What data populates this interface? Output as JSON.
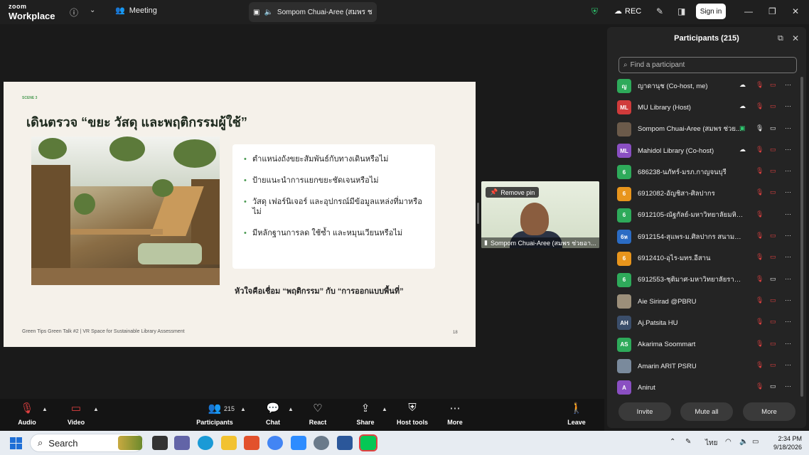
{
  "titlebar": {
    "brand_top": "zoom",
    "brand_bottom": "Workplace",
    "meeting_label": "Meeting",
    "share_tab_label": "Sompom Chuai-Aree (สมพร ช",
    "rec_label": "REC",
    "signin_label": "Sign in"
  },
  "slide": {
    "scene": "SCENE 3",
    "title": "เดินตรวจ “ขยะ วัสดุ และพฤติกรรมผู้ใช้”",
    "bullets": [
      "ตำแหน่งถังขยะสัมพันธ์กับทางเดินหรือไม่",
      "ป้ายแนะนำการแยกขยะชัดเจนหรือไม่",
      "วัสดุ เฟอร์นิเจอร์ และอุปกรณ์มีข้อมูลแหล่งที่มาหรือไม่",
      "มีหลักฐานการลด ใช้ซ้ำ และหมุนเวียนหรือไม่"
    ],
    "summary": "หัวใจคือเชื่อม “พฤติกรรม” กับ “การออกแบบพื้นที่”",
    "footer": "Green Tips Green Talk #2  |  VR Space for Sustainable Library Assessment",
    "page_number": "18"
  },
  "thumbnail": {
    "remove_pin_label": "Remove pin",
    "name": "Sompom Chuai-Aree (สมพร ช่วยอา..."
  },
  "participants": {
    "title": "Participants (215)",
    "search_placeholder": "Find a participant",
    "list": [
      {
        "initials": "ญ",
        "name": "ญาดานุช (Co-host, me)",
        "color": "#2eaa5a"
      },
      {
        "initials": "ML",
        "name": "MU Library (Host)",
        "color": "#d03b3b"
      },
      {
        "initials": "",
        "name": "Sompom Chuai-Aree (สมพร ช่วย...",
        "color": "#6b5a4a"
      },
      {
        "initials": "ML",
        "name": "Mahidol Library (Co-host)",
        "color": "#8a4fc2"
      },
      {
        "initials": "6",
        "name": "686238-นภัทร์-มรภ.กาญจนบุรี",
        "color": "#2eaa5a"
      },
      {
        "initials": "6",
        "name": "6912082-อัญชิสา-ศิลปากร",
        "color": "#e8951c"
      },
      {
        "initials": "6",
        "name": "6912105-ณัฐกัลย์-มหาวิทยาลัยมหิดล",
        "color": "#2eaa5a"
      },
      {
        "initials": "6ห",
        "name": "6912154-สุแพร-ม.ศิลปากร สนามจันทร์",
        "color": "#2b6cc4"
      },
      {
        "initials": "6",
        "name": "6912410-อุไร-มทร.อีสาน",
        "color": "#e8951c"
      },
      {
        "initials": "6",
        "name": "6912553-ชุติมาศ-มหาวิทยาลัยราชภัฏย...",
        "color": "#2eaa5a"
      },
      {
        "initials": "",
        "name": "Aie Sirirad @PBRU",
        "color": "#9c8f7a"
      },
      {
        "initials": "AH",
        "name": "Aj.Patsita HU",
        "color": "#3b4e6b"
      },
      {
        "initials": "AS",
        "name": "Akarima Soommart",
        "color": "#2eaa5a"
      },
      {
        "initials": "",
        "name": "Amarin ARIT PSRU",
        "color": "#7a8a9c"
      },
      {
        "initials": "A",
        "name": "Anirut",
        "color": "#8a4fc2"
      }
    ],
    "invite_label": "Invite",
    "mute_all_label": "Mute all",
    "more_label": "More"
  },
  "toolbar": {
    "audio": "Audio",
    "video": "Video",
    "participants": "Participants",
    "participants_count": "215",
    "chat": "Chat",
    "react": "React",
    "share": "Share",
    "host_tools": "Host tools",
    "more": "More",
    "leave": "Leave"
  },
  "taskbar": {
    "search_label": "Search",
    "language": "ไทย",
    "time": "2:34 PM",
    "date": "9/18/2026"
  }
}
